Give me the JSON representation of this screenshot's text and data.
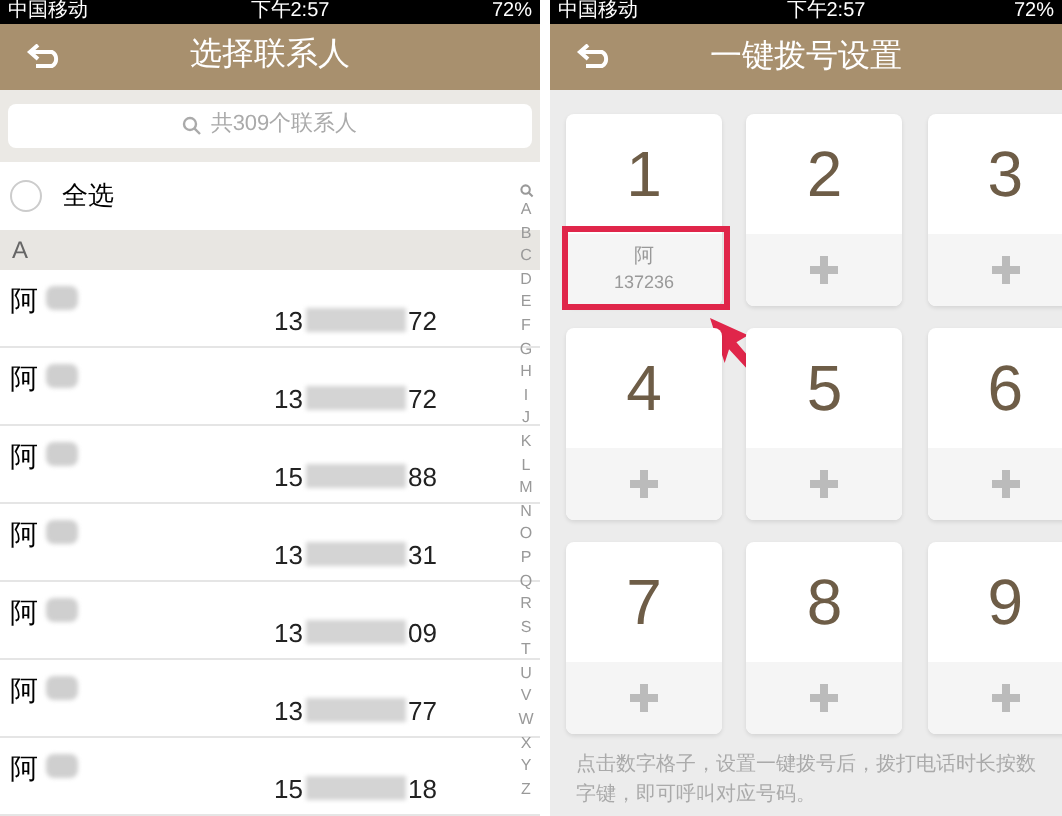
{
  "contacts_screen": {
    "status_bar": {
      "carrier": "中国移动",
      "time": "下午2:57",
      "battery": "72%"
    },
    "title": "选择联系人",
    "search": {
      "placeholder": "共309个联系人"
    },
    "select_all": {
      "label": "全选",
      "checked": false
    },
    "section": "A",
    "contacts": [
      {
        "name": "阿",
        "phone_start": "13",
        "phone_end": "72"
      },
      {
        "name": "阿",
        "phone_start": "13",
        "phone_end": "72"
      },
      {
        "name": "阿",
        "phone_start": "15",
        "phone_end": "88"
      },
      {
        "name": "阿",
        "phone_start": "13",
        "phone_end": "31"
      },
      {
        "name": "阿",
        "phone_start": "13",
        "phone_end": "09"
      },
      {
        "name": "阿",
        "phone_start": "13",
        "phone_end": "77"
      },
      {
        "name": "阿",
        "phone_start": "15",
        "phone_end": "18"
      }
    ],
    "index": [
      "A",
      "B",
      "C",
      "D",
      "E",
      "F",
      "G",
      "H",
      "I",
      "J",
      "K",
      "L",
      "M",
      "N",
      "O",
      "P",
      "Q",
      "R",
      "S",
      "T",
      "U",
      "V",
      "W",
      "X",
      "Y",
      "Z"
    ]
  },
  "speed_dial_screen": {
    "status_bar": {
      "carrier": "中国移动",
      "time": "下午2:57",
      "battery": "72%"
    },
    "title": "一键拨号设置",
    "slots": [
      {
        "number": "1",
        "kind": "assigned",
        "name": "阿",
        "phone": "137236",
        "highlighted": true
      },
      {
        "number": "2",
        "kind": "empty",
        "highlighted": false
      },
      {
        "number": "3",
        "kind": "empty",
        "highlighted": false
      },
      {
        "number": "4",
        "kind": "empty",
        "highlighted": false
      },
      {
        "number": "5",
        "kind": "empty",
        "highlighted": false
      },
      {
        "number": "6",
        "kind": "empty",
        "highlighted": false
      },
      {
        "number": "7",
        "kind": "empty",
        "highlighted": false
      },
      {
        "number": "8",
        "kind": "empty",
        "highlighted": false
      },
      {
        "number": "9",
        "kind": "empty",
        "highlighted": false
      }
    ],
    "hint": "点击数字格子，设置一键拨号后，拨打电话时长按数字键，即可呼叫对应号码。"
  }
}
